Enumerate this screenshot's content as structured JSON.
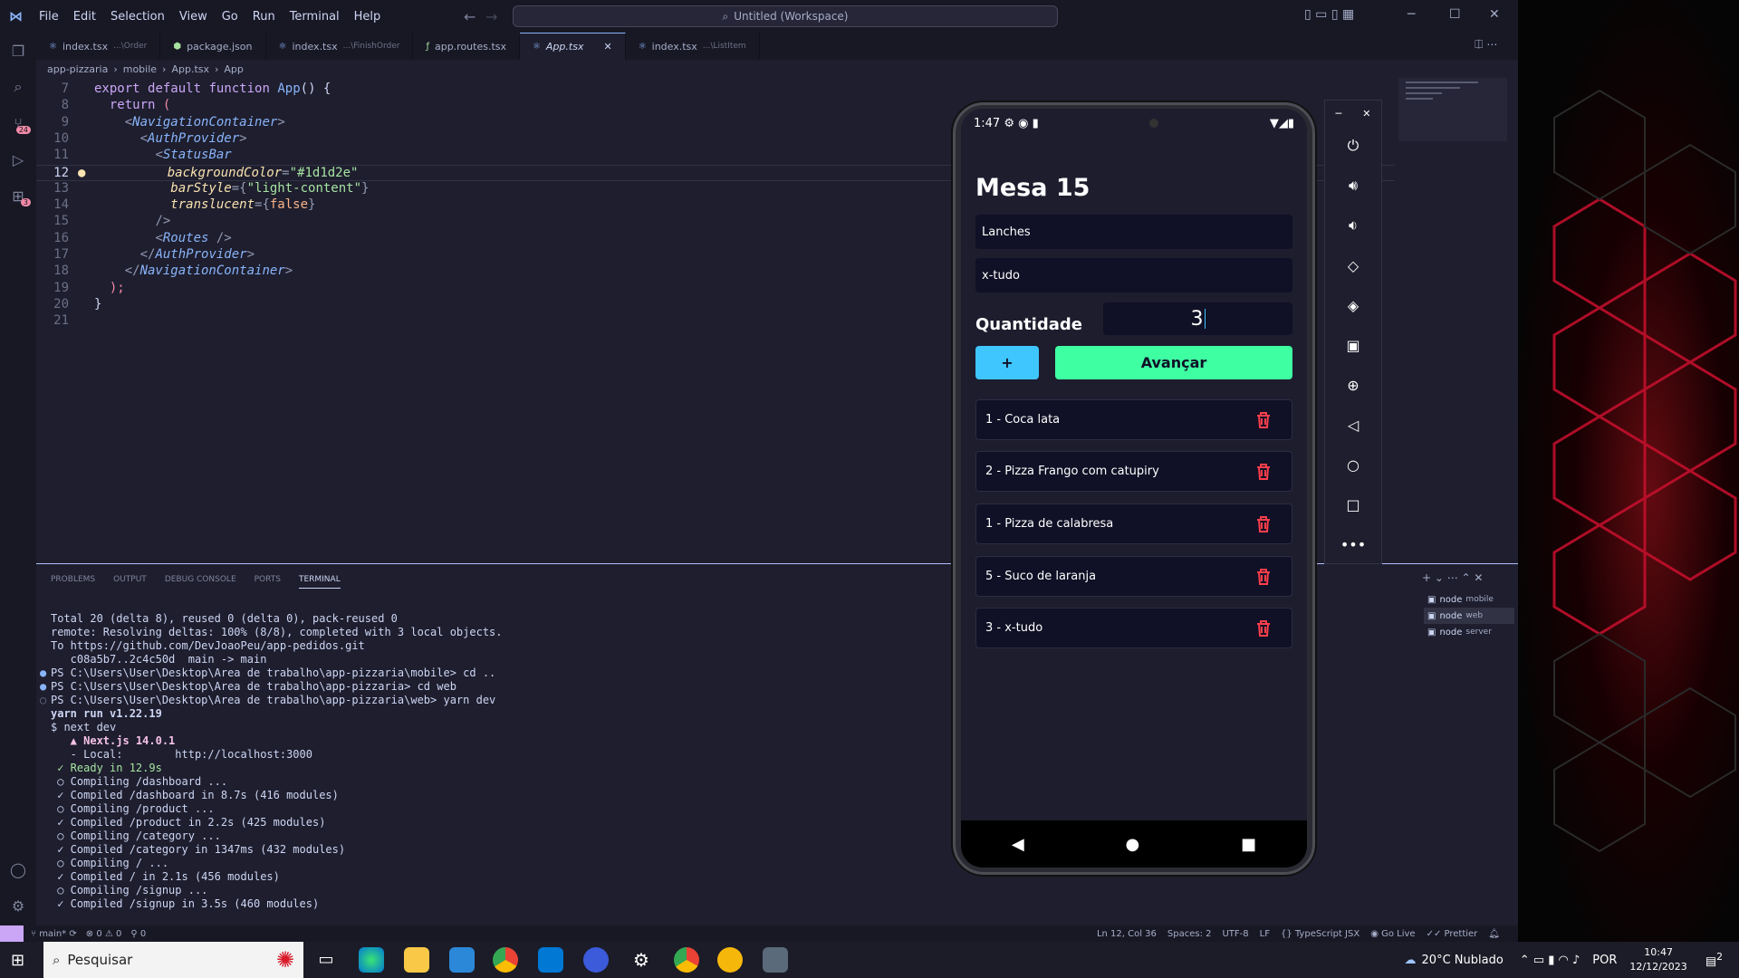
{
  "window": {
    "title": "Untitled (Workspace)"
  },
  "menu": [
    "File",
    "Edit",
    "Selection",
    "View",
    "Go",
    "Run",
    "Terminal",
    "Help"
  ],
  "tabs": [
    {
      "label": "index.tsx",
      "sub": "...\\Order"
    },
    {
      "label": "package.json",
      "sub": ""
    },
    {
      "label": "index.tsx",
      "sub": "...\\FinishOrder"
    },
    {
      "label": "app.routes.tsx",
      "sub": ""
    },
    {
      "label": "App.tsx",
      "sub": ""
    },
    {
      "label": "index.tsx",
      "sub": "...\\ListItem"
    }
  ],
  "breadcrumb": [
    "app-pizzaria",
    "mobile",
    "App.tsx",
    "App"
  ],
  "activity_badges": {
    "source_control": "24",
    "extensions": "3"
  },
  "code": {
    "line_numbers": [
      "7",
      "8",
      "9",
      "10",
      "11",
      "12",
      "13",
      "14",
      "15",
      "16",
      "17",
      "18",
      "19",
      "20",
      "21"
    ],
    "l7_kw1": "export",
    "l7_kw2": "default",
    "l7_kw3": "function",
    "l7_fn": "App",
    "l7_rest": "() {",
    "l8_kw": "return",
    "l8_rest": "(",
    "l9": "NavigationContainer",
    "l10": "AuthProvider",
    "l11": "StatusBar",
    "l12_attr": "backgroundColor",
    "l12_val": "\"#1d1d2e\"",
    "l13_attr": "barStyle",
    "l13_val": "\"light-content\"",
    "l14_attr": "translucent",
    "l14_val": "false",
    "l15": "/>",
    "l16": "Routes",
    "l17": "AuthProvider",
    "l18": "NavigationContainer",
    "l19": ");",
    "l20": "}"
  },
  "panel": {
    "tabs": [
      "PROBLEMS",
      "OUTPUT",
      "DEBUG CONSOLE",
      "PORTS",
      "TERMINAL"
    ],
    "active": "TERMINAL"
  },
  "terminal": [
    "Total 20 (delta 8), reused 0 (delta 0), pack-reused 0",
    "remote: Resolving deltas: 100% (8/8), completed with 3 local objects.",
    "To https://github.com/DevJoaoPeu/app-pedidos.git",
    "   c08a5b7..2c4c50d  main -> main",
    "PS C:\\Users\\User\\Desktop\\Area de trabalho\\app-pizzaria\\mobile> cd ..",
    "PS C:\\Users\\User\\Desktop\\Area de trabalho\\app-pizzaria> cd web",
    "PS C:\\Users\\User\\Desktop\\Area de trabalho\\app-pizzaria\\web> yarn dev",
    "yarn run v1.22.19",
    "$ next dev",
    "   ▲ Next.js 14.0.1",
    "   - Local:        http://localhost:3000",
    "",
    " ✓ Ready in 12.9s",
    " ○ Compiling /dashboard ...",
    " ✓ Compiled /dashboard in 8.7s (416 modules)",
    " ○ Compiling /product ...",
    " ✓ Compiled /product in 2.2s (425 modules)",
    " ○ Compiling /category ...",
    " ✓ Compiled /category in 1347ms (432 modules)",
    " ○ Compiling / ...",
    " ✓ Compiled / in 2.1s (456 modules)",
    " ○ Compiling /signup ...",
    " ✓ Compiled /signup in 3.5s (460 modules)"
  ],
  "terminal_list": [
    {
      "name": "node",
      "sub": "mobile"
    },
    {
      "name": "node",
      "sub": "web"
    },
    {
      "name": "node",
      "sub": "server"
    }
  ],
  "statusbar": {
    "branch": "main*",
    "problems": "0",
    "warnings": "0",
    "ports": "0",
    "position": "Ln 12, Col 36",
    "spaces": "Spaces: 2",
    "encoding": "UTF-8",
    "eol": "LF",
    "language": "TypeScript JSX",
    "golive": "Go Live",
    "prettier": "Prettier"
  },
  "phone": {
    "time": "1:47",
    "title": "Mesa 15",
    "category": "Lanches",
    "product": "x-tudo",
    "qty_label": "Quantidade",
    "qty_value": "3",
    "add_label": "+",
    "next_label": "Avançar",
    "items": [
      "1 - Coca lata",
      "2 - Pizza Frango com catupiry",
      "1 - Pizza de calabresa",
      "5 - Suco de laranja",
      "3 - x-tudo"
    ]
  },
  "taskbar": {
    "search_placeholder": "Pesquisar",
    "weather": "20°C  Nublado",
    "lang": "POR",
    "time": "10:47",
    "date": "12/12/2023",
    "notif": "2"
  },
  "colors": {
    "accent": "#3fffa3",
    "add": "#3fc6ff",
    "trash": "#ff3f4b",
    "app_bg": "#1d1d2e"
  }
}
